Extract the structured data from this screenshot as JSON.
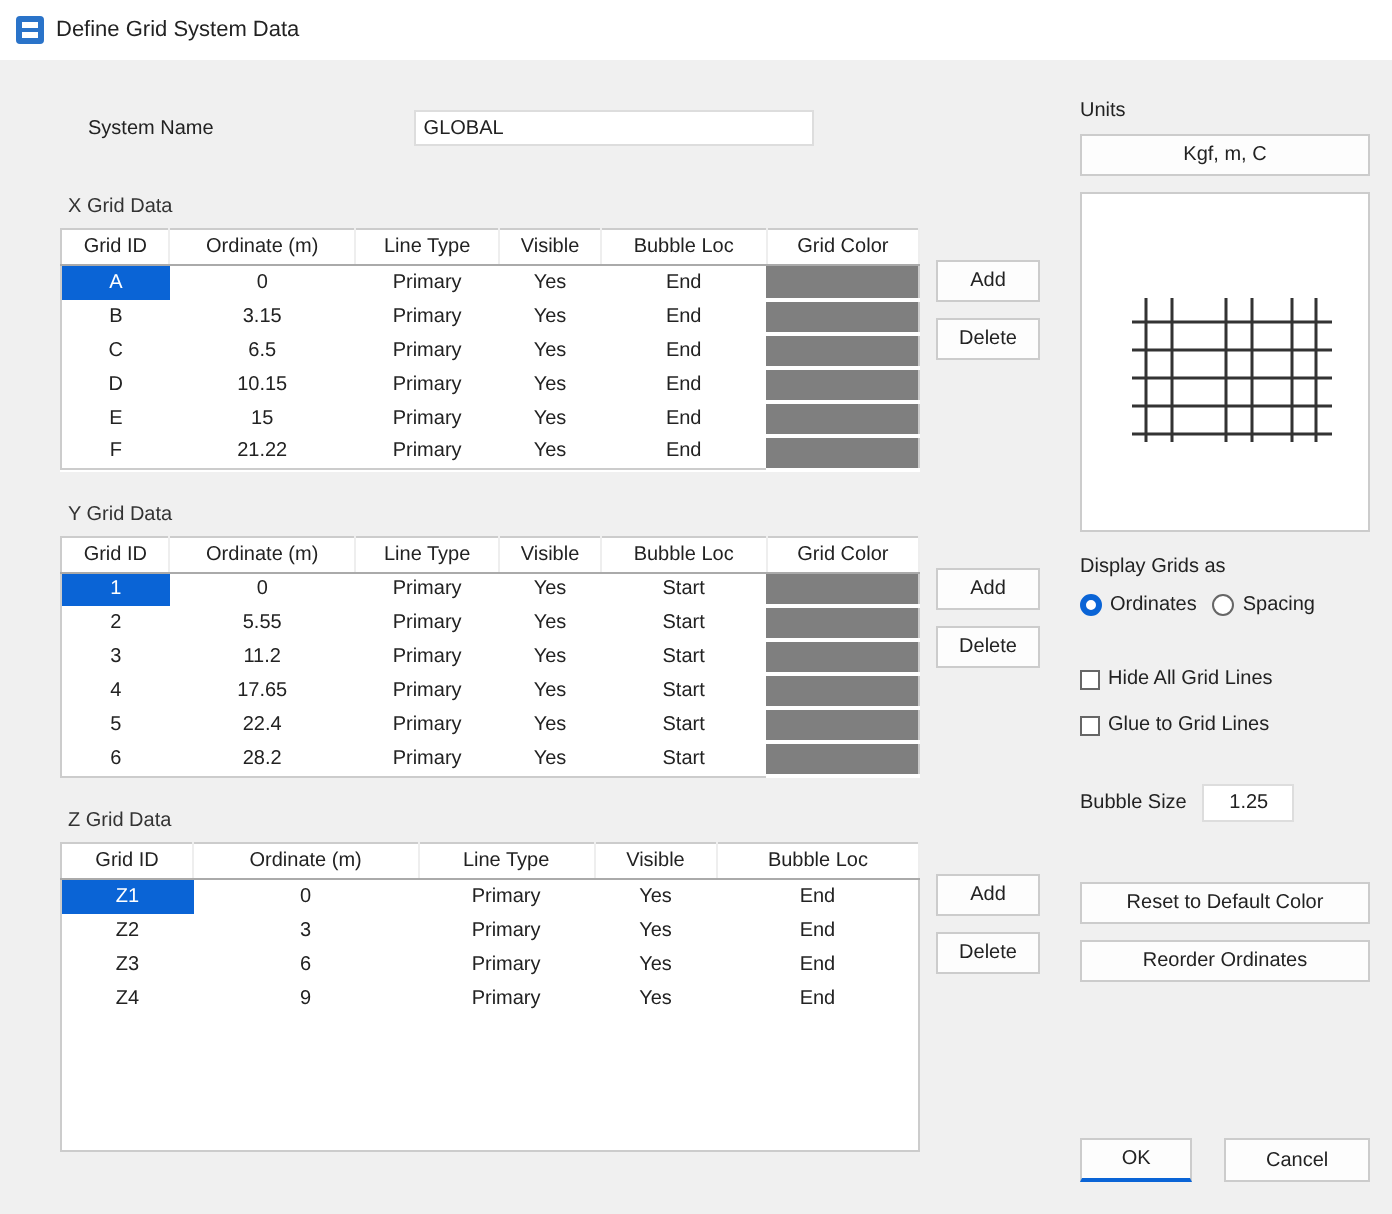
{
  "window": {
    "title": "Define Grid System Data"
  },
  "system_name": {
    "label": "System Name",
    "value": "GLOBAL"
  },
  "grids": [
    {
      "title": "X Grid Data",
      "columns": [
        "Grid ID",
        "Ordinate (m)",
        "Line Type",
        "Visible",
        "Bubble Loc",
        "Grid Color"
      ],
      "buttons": [
        "Add",
        "Delete"
      ],
      "rows": [
        {
          "cells": [
            "A",
            "0",
            "Primary",
            "Yes",
            "End"
          ],
          "color": "#7f7f7f",
          "selected": true
        },
        {
          "cells": [
            "B",
            "3.15",
            "Primary",
            "Yes",
            "End"
          ],
          "color": "#7f7f7f",
          "selected": false
        },
        {
          "cells": [
            "C",
            "6.5",
            "Primary",
            "Yes",
            "End"
          ],
          "color": "#7f7f7f",
          "selected": false
        },
        {
          "cells": [
            "D",
            "10.15",
            "Primary",
            "Yes",
            "End"
          ],
          "color": "#7f7f7f",
          "selected": false
        },
        {
          "cells": [
            "E",
            "15",
            "Primary",
            "Yes",
            "End"
          ],
          "color": "#7f7f7f",
          "selected": false
        },
        {
          "cells": [
            "F",
            "21.22",
            "Primary",
            "Yes",
            "End"
          ],
          "color": "#7f7f7f",
          "selected": false
        }
      ]
    },
    {
      "title": "Y Grid Data",
      "columns": [
        "Grid ID",
        "Ordinate (m)",
        "Line Type",
        "Visible",
        "Bubble Loc",
        "Grid Color"
      ],
      "buttons": [
        "Add",
        "Delete"
      ],
      "rows": [
        {
          "cells": [
            "1",
            "0",
            "Primary",
            "Yes",
            "Start"
          ],
          "color": "#7f7f7f",
          "selected": true
        },
        {
          "cells": [
            "2",
            "5.55",
            "Primary",
            "Yes",
            "Start"
          ],
          "color": "#7f7f7f",
          "selected": false
        },
        {
          "cells": [
            "3",
            "11.2",
            "Primary",
            "Yes",
            "Start"
          ],
          "color": "#7f7f7f",
          "selected": false
        },
        {
          "cells": [
            "4",
            "17.65",
            "Primary",
            "Yes",
            "Start"
          ],
          "color": "#7f7f7f",
          "selected": false
        },
        {
          "cells": [
            "5",
            "22.4",
            "Primary",
            "Yes",
            "Start"
          ],
          "color": "#7f7f7f",
          "selected": false
        },
        {
          "cells": [
            "6",
            "28.2",
            "Primary",
            "Yes",
            "Start"
          ],
          "color": "#7f7f7f",
          "selected": false
        }
      ]
    },
    {
      "title": "Z Grid Data",
      "columns": [
        "Grid ID",
        "Ordinate (m)",
        "Line Type",
        "Visible",
        "Bubble Loc"
      ],
      "buttons": [
        "Add",
        "Delete"
      ],
      "rows": [
        {
          "cells": [
            "Z1",
            "0",
            "Primary",
            "Yes",
            "End"
          ],
          "selected": true
        },
        {
          "cells": [
            "Z2",
            "3",
            "Primary",
            "Yes",
            "End"
          ],
          "selected": false
        },
        {
          "cells": [
            "Z3",
            "6",
            "Primary",
            "Yes",
            "End"
          ],
          "selected": false
        },
        {
          "cells": [
            "Z4",
            "9",
            "Primary",
            "Yes",
            "End"
          ],
          "selected": false
        }
      ]
    }
  ],
  "units": {
    "label": "Units",
    "button": "Kgf, m, C"
  },
  "display": {
    "label": "Display Grids as",
    "options": [
      {
        "label": "Ordinates",
        "selected": true
      },
      {
        "label": "Spacing",
        "selected": false
      }
    ]
  },
  "checks": [
    {
      "label": "Hide All Grid Lines",
      "checked": false
    },
    {
      "label": "Glue to Grid Lines",
      "checked": false
    }
  ],
  "bubble_size": {
    "label": "Bubble Size",
    "value": "1.25"
  },
  "side_buttons": [
    "Reset to Default Color",
    "Reorder Ordinates"
  ],
  "dialog_buttons": [
    "OK",
    "Cancel"
  ]
}
